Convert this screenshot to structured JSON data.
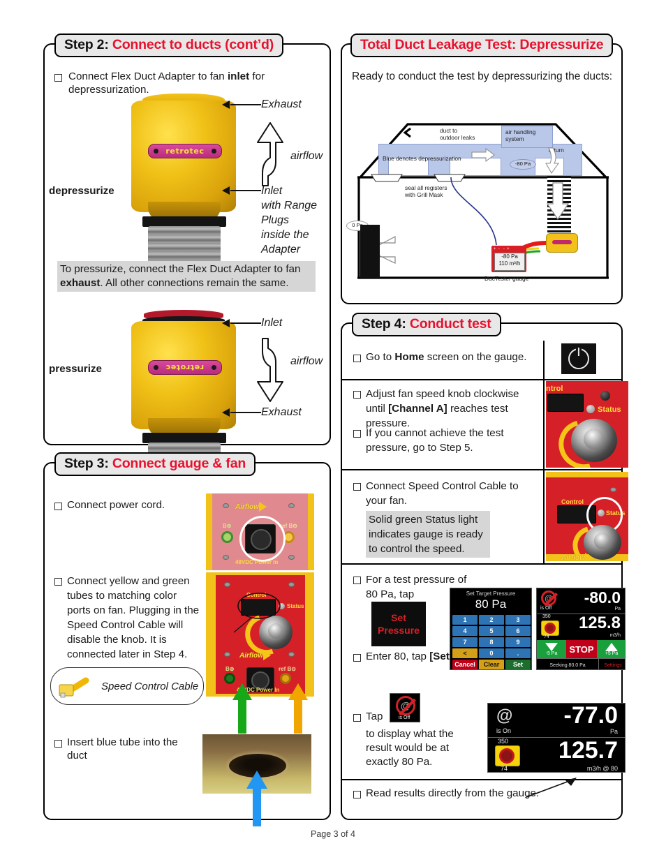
{
  "page": {
    "footer": "Page 3 of 4"
  },
  "step2": {
    "title_step": "Step 2:",
    "title_name": "Connect to ducts (cont’d)",
    "bullet1": "Connect Flex Duct Adapter to fan ",
    "bullet1_bold": "inlet",
    "bullet1_end": " for depressurization.",
    "label_depressurize": "depressurize",
    "label_pressurize": "pressurize",
    "fan_logo": "retrotec",
    "callouts_top": {
      "exhaust": "Exhaust",
      "airflow": "airflow",
      "inlet": "Inlet",
      "inlet_line2": "with Range Plugs",
      "inlet_line3": "inside the Adapter"
    },
    "callouts_bottom": {
      "inlet": "Inlet",
      "airflow": "airflow",
      "exhaust": "Exhaust"
    },
    "note": "To pressurize, connect the Flex Duct Adapter to fan ",
    "note_bold": "exhaust",
    "note_end": ". All other connections remain the same."
  },
  "step3": {
    "title_step": "Step 3:",
    "title_name": "Connect gauge & fan",
    "item1": "Connect power cord.",
    "item2": "Connect yellow and green tubes to matching color ports on fan. Plugging in the Speed Control Cable will disable the knob. It is connected later in Step 4.",
    "item3": "Insert blue tube into the duct",
    "cable_callout": "Speed Control Cable",
    "panel_labels": {
      "airflow": "Airflow",
      "power_in": "48VDC Power In",
      "port_b": "B⊕",
      "port_ref_b": "ref B⊖",
      "control": "Control",
      "status": "Status"
    }
  },
  "right_header": {
    "title": "Total Duct Leakage Test: Depressurize",
    "intro": "Ready to conduct the test by depressurizing the ducts:"
  },
  "diagram": {
    "duct_to_outdoor": "duct to\noutdoor leaks",
    "air_handling": "air handling\nsystem",
    "return": "return",
    "blue_note": "Blue denotes depressurization",
    "seal_note": "seal all registers\nwith Grill Mask",
    "pa_duct": "-80 Pa",
    "pa_house": "0 Pa",
    "gauge_reading_1": "-80 Pa",
    "gauge_reading_2": "110 m³/h",
    "gauge_label": "DucTester gauge"
  },
  "step4": {
    "title_step": "Step 4:",
    "title_name": "Conduct test",
    "rows": [
      {
        "text_a": "Go to ",
        "bold": "Home",
        "text_b": " screen on the gauge."
      },
      {
        "text_a": "Adjust fan speed knob clockwise until ",
        "bold": "[Channel A]",
        "text_b": " reaches test pressure."
      },
      {
        "text_a": "If you cannot achieve the test pressure, go to Step 5.",
        "bold": "",
        "text_b": ""
      },
      {
        "text_a": "Connect Speed Control Cable to your fan.",
        "bold": "",
        "text_b": ""
      },
      {
        "text_a": "For a test pressure of 80 Pa, tap",
        "bold": "",
        "text_b": ""
      },
      {
        "text_a": "Enter 80, tap ",
        "bold": "[Set]",
        "text_b": ""
      },
      {
        "text_a": "Tap",
        "bold": "",
        "text_b": ""
      },
      {
        "text_a": "Read results directly from the gauge.",
        "bold": "",
        "text_b": ""
      }
    ],
    "status_note": "Solid green Status light indicates gauge is ready to control the speed.",
    "tap_note": "to display what the result would be at exactly 80 Pa.",
    "set_pressure_button": "Set\nPressure",
    "set_pressure_l1": "Set",
    "set_pressure_l2": "Pressure",
    "panel_labels": {
      "control": "Control",
      "ntrol": "ntrol",
      "status": "Status"
    }
  },
  "keypad": {
    "title": "Set Target Pressure",
    "value": "80 Pa",
    "keys": [
      "1",
      "2",
      "3",
      "4",
      "5",
      "6",
      "7",
      "8",
      "9",
      "<",
      "0",
      "."
    ],
    "cancel": "Cancel",
    "clear": "Clear",
    "set": "Set"
  },
  "gauge_screen_1": {
    "channel_icon": "is Off",
    "pressure": "-80.0",
    "pressure_unit": "Pa",
    "flow": "125.8",
    "flow_unit": "m3/h",
    "range_top": "350",
    "range_bottom": "74",
    "btn_down": "-5 Pa",
    "btn_stop": "STOP",
    "btn_up": "+5 Pa",
    "status": "Seeking 80.0 Pa",
    "settings": "Settings"
  },
  "gauge_screen_2": {
    "at_symbol": "@",
    "channel_icon": "is On",
    "pressure": "-77.0",
    "pressure_unit": "Pa",
    "flow": "125.7",
    "flow_unit": "m3/h @ 80",
    "range_top": "350",
    "range_bottom": "74"
  },
  "colors": {
    "accent_red": "#e8112d",
    "device_red": "#d62027",
    "device_yellow": "#f2c21a",
    "blue_fill": "#b9c7e8",
    "key_blue": "#2e74b5"
  }
}
